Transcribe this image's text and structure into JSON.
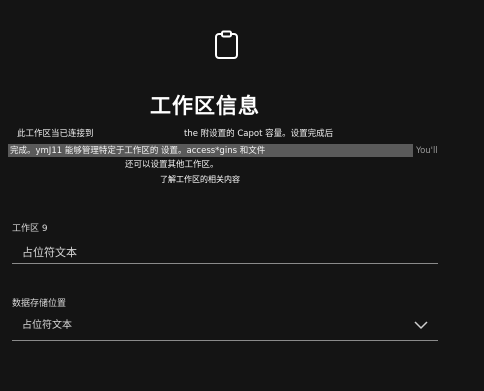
{
  "header": {
    "icon": "clipboard-icon",
    "title": "工作区信息"
  },
  "description": {
    "line1_left": "此工作区当已连接到",
    "line1_right": "the 附设置的 Capot 容量。设置完成后",
    "line2": "完成。ymJ11 能够管理特定于工作区的 设置。access*gins 和文件",
    "line2_tail": "You'll",
    "line3": "还可以设置其他工作区。",
    "learn_more": "了解工作区的相关内容"
  },
  "workspace_field": {
    "label": "工作区 9",
    "value": "占位符文本"
  },
  "location_field": {
    "label": "数据存储位置",
    "value": "占位符文本",
    "icon": "chevron-down-icon"
  },
  "colors": {
    "background": "#141414",
    "highlight": "#5a5a5a",
    "text": "#e8e8e8",
    "underline": "#8a8a8a"
  }
}
